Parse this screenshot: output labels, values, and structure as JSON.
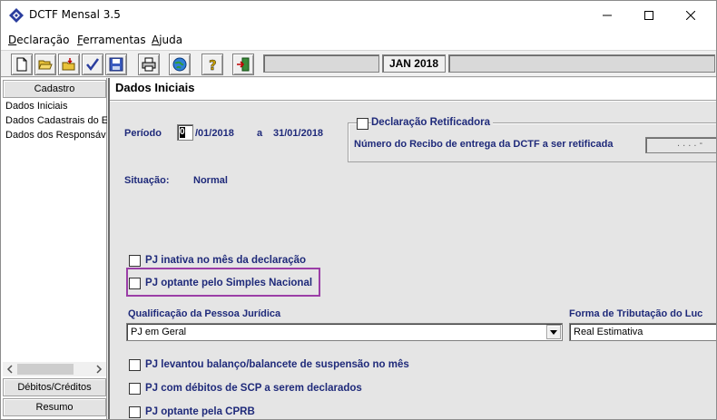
{
  "window": {
    "title": "DCTF Mensal 3.5"
  },
  "menu": {
    "items": [
      {
        "label_first": "D",
        "label_rest": "eclaração"
      },
      {
        "label_first": "F",
        "label_rest": "erramentas"
      },
      {
        "label_first": "A",
        "label_rest": "juda"
      }
    ]
  },
  "toolbar": {
    "month": "JAN 2018",
    "icons": [
      "new-file-icon",
      "open-folder-icon",
      "import-icon",
      "validate-check-icon",
      "save-disk-icon",
      "print-icon",
      "globe-transmit-icon",
      "help-icon",
      "exit-door-icon"
    ]
  },
  "nav": {
    "cadastro_label": "Cadastro",
    "items": [
      "Dados Iniciais",
      "Dados Cadastrais do E",
      "Dados dos Responsáv"
    ],
    "debitos_label": "Débitos/Créditos",
    "resumo_label": "Resumo"
  },
  "panel": {
    "title": "Dados Iniciais",
    "periodo_label": "Período",
    "periodo_day": "01",
    "periodo_start_rest": "/01/2018",
    "periodo_sep": "a",
    "periodo_end": "31/01/2018",
    "retificadora_label": "Declaração Retificadora",
    "recibo_label": "Número do Recibo de entrega da DCTF a ser retificada",
    "recibo_value": ". . . . -",
    "situacao_label": "Situação:",
    "situacao_value": "Normal",
    "pj_inativa": "PJ inativa no mês da declaração",
    "pj_simples": "PJ optante pelo Simples Nacional",
    "qualificacao_label": "Qualificação da Pessoa Jurídica",
    "qualificacao_value": "PJ em Geral",
    "tributacao_label": "Forma de Tributação do Luc",
    "tributacao_value": "Real Estimativa",
    "pj_balanco": "PJ levantou balanço/balancete de suspensão no mês",
    "pj_scp": "PJ com débitos de SCP a serem declarados",
    "pj_cprb": "PJ optante pela CPRB"
  }
}
